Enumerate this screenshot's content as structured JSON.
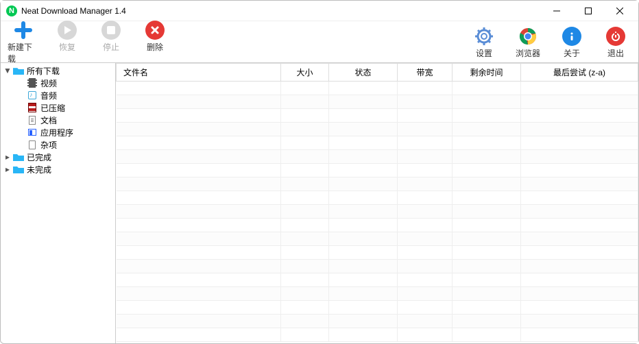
{
  "window": {
    "title": "Neat Download Manager 1.4"
  },
  "toolbar": {
    "left": [
      {
        "id": "new",
        "label": "新建下载",
        "muted": false
      },
      {
        "id": "resume",
        "label": "恢复",
        "muted": true
      },
      {
        "id": "stop",
        "label": "停止",
        "muted": true
      },
      {
        "id": "delete",
        "label": "删除",
        "muted": false
      }
    ],
    "right": [
      {
        "id": "settings",
        "label": "设置"
      },
      {
        "id": "browser",
        "label": "浏览器"
      },
      {
        "id": "about",
        "label": "关于"
      },
      {
        "id": "exit",
        "label": "退出"
      }
    ]
  },
  "sidebar": {
    "roots": [
      {
        "id": "all",
        "label": "所有下载",
        "expanded": true,
        "children": [
          {
            "id": "video",
            "label": "视频",
            "icon": "film"
          },
          {
            "id": "audio",
            "label": "音频",
            "icon": "audio"
          },
          {
            "id": "archive",
            "label": "已压缩",
            "icon": "archive"
          },
          {
            "id": "doc",
            "label": "文档",
            "icon": "doc"
          },
          {
            "id": "app",
            "label": "应用程序",
            "icon": "app"
          },
          {
            "id": "misc",
            "label": "杂项",
            "icon": "blank"
          }
        ]
      },
      {
        "id": "finished",
        "label": "已完成",
        "expanded": false
      },
      {
        "id": "unfinished",
        "label": "未完成",
        "expanded": false
      }
    ]
  },
  "table": {
    "columns": [
      "文件名",
      "大小",
      "状态",
      "带宽",
      "剩余时间",
      "最后尝试 (z-a)"
    ],
    "rows": []
  }
}
